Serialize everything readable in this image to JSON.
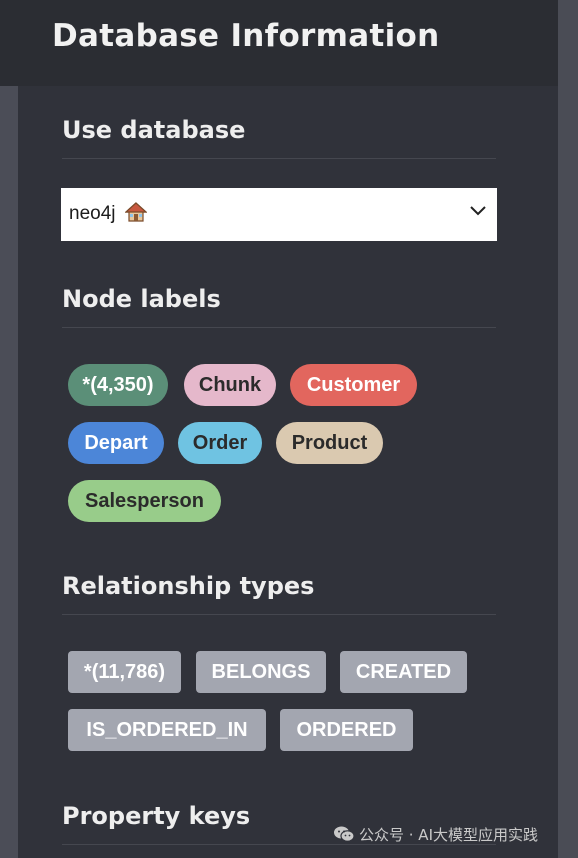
{
  "panel": {
    "title": "Database Information"
  },
  "database": {
    "heading": "Use database",
    "selected": "neo4j",
    "icon": "house-icon"
  },
  "node_labels": {
    "heading": "Node labels",
    "items": [
      {
        "label": "*(4,350)",
        "color": "#5b8f78",
        "text_color": "#ffffff"
      },
      {
        "label": "Chunk",
        "color": "#e5b8cb",
        "text_color": "#2b2b2b"
      },
      {
        "label": "Customer",
        "color": "#e2665e",
        "text_color": "#ffffff"
      },
      {
        "label": "Depart",
        "color": "#4c86d8",
        "text_color": "#ffffff"
      },
      {
        "label": "Order",
        "color": "#6fc3e2",
        "text_color": "#2b2b2b"
      },
      {
        "label": "Product",
        "color": "#dac9b0",
        "text_color": "#2b2b2b"
      },
      {
        "label": "Salesperson",
        "color": "#98cc8a",
        "text_color": "#2b2b2b"
      }
    ]
  },
  "relationship_types": {
    "heading": "Relationship types",
    "items": [
      {
        "label": "*(11,786)"
      },
      {
        "label": "BELONGS"
      },
      {
        "label": "CREATED"
      },
      {
        "label": "IS_ORDERED_IN"
      },
      {
        "label": "ORDERED"
      }
    ]
  },
  "property_keys": {
    "heading": "Property keys"
  },
  "watermark": {
    "text": "公众号 · AI大模型应用实践",
    "icon": "wechat-icon"
  }
}
